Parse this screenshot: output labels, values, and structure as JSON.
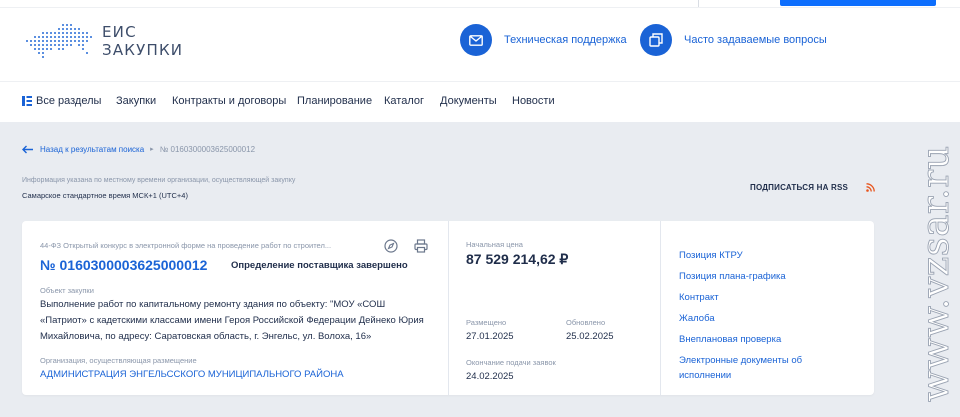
{
  "header": {
    "logo_line1": "ЕИС",
    "logo_line2": "ЗАКУПКИ",
    "support_label": "Техническая поддержка",
    "faq_label": "Часто задаваемые вопросы",
    "accent_color": "#1a63d6"
  },
  "nav": {
    "items": [
      "Все разделы",
      "Закупки",
      "Контракты и договоры",
      "Планирование",
      "Каталог",
      "Документы",
      "Новости"
    ]
  },
  "breadcrumb": {
    "back_label": "Назад к результатам поиска",
    "current": "№ 0160300003625000012"
  },
  "timezone": {
    "note": "Информация указана по местному времени организации, осуществляющей закупку",
    "value": "Самарское стандартное время МСК+1 (UTC+4)"
  },
  "rss": {
    "label": "ПОДПИСАТЬСЯ НА RSS"
  },
  "procurement": {
    "type": "44-ФЗ Открытый конкурс в электронной форме на проведение работ по строител...",
    "number": "№ 0160300003625000012",
    "status": "Определение поставщика завершено",
    "object_label": "Объект закупки",
    "object_text": "Выполнение работ по капитальному ремонту здания по объекту: \"МОУ «СОШ «Патриот» с кадетскими классами имени Героя Российской Федерации Дейнеко Юрия Михайловича, по адресу: Саратовская область, г. Энгельс, ул. Волоха, 16»",
    "org_label": "Организация, осуществляющая размещение",
    "org_name": "АДМИНИСТРАЦИЯ ЭНГЕЛЬССКОГО МУНИЦИПАЛЬНОГО РАЙОНА",
    "price_label": "Начальная цена",
    "price": "87 529 214,62 ₽",
    "posted_label": "Размещено",
    "posted_date": "27.01.2025",
    "updated_label": "Обновлено",
    "updated_date": "25.02.2025",
    "deadline_label": "Окончание подачи заявок",
    "deadline_date": "24.02.2025"
  },
  "side_links": [
    "Позиция КТРУ",
    "Позиция плана-графика",
    "Контракт",
    "Жалоба",
    "Внеплановая проверка",
    "Электронные документы об исполнении"
  ],
  "watermark": "www.vzsar.ru"
}
